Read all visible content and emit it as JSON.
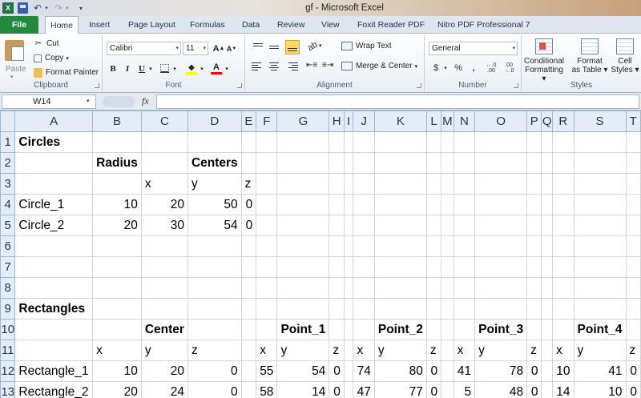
{
  "window": {
    "title": "gf - Microsoft Excel",
    "app_badge": "X"
  },
  "quick_access": {
    "undo": "↶",
    "redo": "↷",
    "dropdown": "▾"
  },
  "tabs": [
    {
      "label": "File"
    },
    {
      "label": "Home"
    },
    {
      "label": "Insert"
    },
    {
      "label": "Page Layout"
    },
    {
      "label": "Formulas"
    },
    {
      "label": "Data"
    },
    {
      "label": "Review"
    },
    {
      "label": "View"
    },
    {
      "label": "Foxit Reader PDF"
    },
    {
      "label": "Nitro PDF Professional 7"
    }
  ],
  "ribbon": {
    "clipboard": {
      "paste": "Paste",
      "cut": "Cut",
      "copy": "Copy",
      "format_painter": "Format Painter",
      "label": "Clipboard"
    },
    "font": {
      "name": "Calibri",
      "size": "11",
      "bold": "B",
      "italic": "I",
      "underline": "U",
      "color_glyph": "A",
      "label": "Font"
    },
    "alignment": {
      "wrap_text": "Wrap Text",
      "merge_center": "Merge & Center",
      "label": "Alignment"
    },
    "number": {
      "format": "General",
      "currency": "$",
      "percent": "%",
      "comma": ",",
      "label": "Number"
    },
    "styles": {
      "conditional": [
        "Conditional",
        "Formatting ▾"
      ],
      "as_table": [
        "Format",
        "as Table ▾"
      ],
      "cell_styles": [
        "Cell",
        "Styles ▾"
      ],
      "label": "Styles"
    },
    "colors": {
      "fill": "#ffff00",
      "font_color": "#ff0000",
      "file_tab": "#23893d"
    }
  },
  "formula_bar": {
    "name_box": "W14",
    "fx": "fx",
    "value": ""
  },
  "grid": {
    "columns": [
      "A",
      "B",
      "C",
      "D",
      "E",
      "F",
      "G",
      "H",
      "I",
      "J",
      "K",
      "L",
      "M",
      "N",
      "O",
      "P",
      "Q",
      "R",
      "S",
      "T"
    ],
    "rows": [
      {
        "n": "1",
        "cells": {
          "A": "Circles"
        }
      },
      {
        "n": "2",
        "cells": {
          "B": "Radius",
          "D": "Centers"
        }
      },
      {
        "n": "3",
        "cells": {
          "C": "x",
          "D": "y",
          "E": "z"
        }
      },
      {
        "n": "4",
        "cells": {
          "A": "Circle_1",
          "B": "10",
          "C": "20",
          "D": "50",
          "E": "0"
        }
      },
      {
        "n": "5",
        "cells": {
          "A": "Circle_2",
          "B": "20",
          "C": "30",
          "D": "54",
          "E": "0"
        }
      },
      {
        "n": "6",
        "cells": {}
      },
      {
        "n": "7",
        "cells": {}
      },
      {
        "n": "8",
        "cells": {}
      },
      {
        "n": "9",
        "cells": {
          "A": "Rectangles"
        }
      },
      {
        "n": "10",
        "cells": {
          "C": "Center",
          "G": "Point_1",
          "K": "Point_2",
          "O": "Point_3",
          "S": "Point_4"
        }
      },
      {
        "n": "11",
        "cells": {
          "B": "x",
          "C": "y",
          "D": "z",
          "F": "x",
          "G": "y",
          "H": "z",
          "J": "x",
          "K": "y",
          "L": "z",
          "N": "x",
          "O": "y",
          "P": "z",
          "R": "x",
          "S": "y",
          "T": "z"
        }
      },
      {
        "n": "12",
        "cells": {
          "A": "Rectangle_1",
          "B": "10",
          "C": "20",
          "D": "0",
          "F": "55",
          "G": "54",
          "H": "0",
          "J": "74",
          "K": "80",
          "L": "0",
          "N": "41",
          "O": "78",
          "P": "0",
          "R": "10",
          "S": "41",
          "T": "0"
        }
      },
      {
        "n": "13",
        "cells": {
          "A": "Rectangle_2",
          "B": "20",
          "C": "24",
          "D": "0",
          "F": "58",
          "G": "14",
          "H": "0",
          "J": "47",
          "K": "77",
          "L": "0",
          "N": "5",
          "O": "48",
          "P": "0",
          "R": "14",
          "S": "10",
          "T": "0"
        }
      }
    ]
  }
}
